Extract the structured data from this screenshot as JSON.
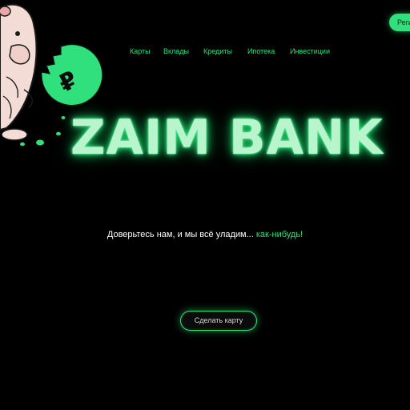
{
  "header": {
    "register_label": "Регистрация"
  },
  "nav": {
    "items": [
      {
        "label": "Карты"
      },
      {
        "label": "Вклады"
      },
      {
        "label": "Кредиты"
      },
      {
        "label": "Ипотека"
      },
      {
        "label": "Инвестиции"
      }
    ]
  },
  "hero": {
    "logo_text": "ZAIM BANK",
    "tagline_main": "Доверьтесь нам, и мы всё уладим... ",
    "tagline_accent": "как-нибудь!",
    "cta_label": "Сделать карту",
    "coin_symbol": "₽"
  },
  "colors": {
    "background": "#000000",
    "accent": "#2fe07c",
    "logo_glow": "#b8f5cc"
  },
  "icons": {
    "mascot": "hamster-with-ruble-coin"
  }
}
